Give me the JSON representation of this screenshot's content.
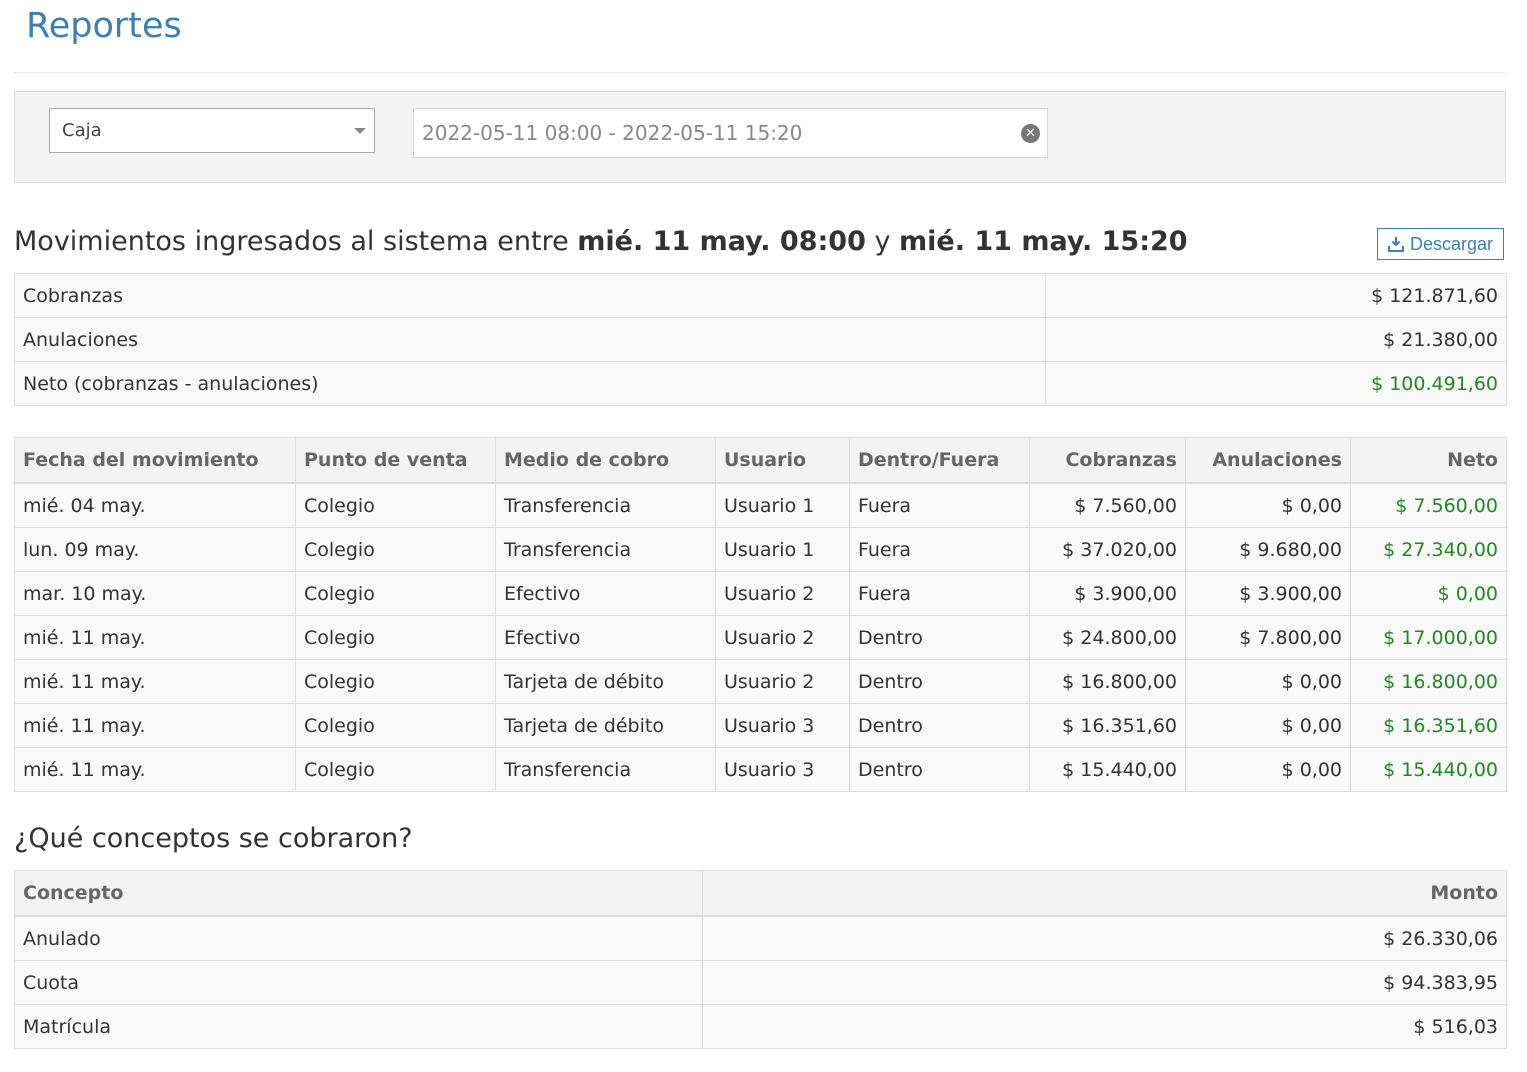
{
  "header": {
    "title": "Reportes"
  },
  "filters": {
    "select_value": "Caja",
    "date_range": "2022-05-11 08:00 - 2022-05-11 15:20",
    "clear_glyph": "✕"
  },
  "movements_heading": {
    "prefix": "Movimientos ingresados al sistema entre ",
    "start": "mié. 11 may. 08:00",
    "connector": " y ",
    "end": "mié. 11 may. 15:20"
  },
  "download_button": {
    "label": "Descargar",
    "icon": "download-icon"
  },
  "summary": [
    {
      "label": "Cobranzas",
      "value": "$ 121.871,60"
    },
    {
      "label": "Anulaciones",
      "value": "$ 21.380,00"
    },
    {
      "label": "Neto (cobranzas - anulaciones)",
      "value": "$ 100.491,60"
    }
  ],
  "movements": {
    "columns": [
      "Fecha del movimiento",
      "Punto de venta",
      "Medio de cobro",
      "Usuario",
      "Dentro/Fuera",
      "Cobranzas",
      "Anulaciones",
      "Neto"
    ],
    "rows": [
      [
        "mié. 04 may.",
        "Colegio",
        "Transferencia",
        "Usuario 1",
        "Fuera",
        "$ 7.560,00",
        "$ 0,00",
        "$ 7.560,00"
      ],
      [
        "lun. 09 may.",
        "Colegio",
        "Transferencia",
        "Usuario 1",
        "Fuera",
        "$ 37.020,00",
        "$ 9.680,00",
        "$ 27.340,00"
      ],
      [
        "mar. 10 may.",
        "Colegio",
        "Efectivo",
        "Usuario 2",
        "Fuera",
        "$ 3.900,00",
        "$ 3.900,00",
        "$ 0,00"
      ],
      [
        "mié. 11 may.",
        "Colegio",
        "Efectivo",
        "Usuario 2",
        "Dentro",
        "$ 24.800,00",
        "$ 7.800,00",
        "$ 17.000,00"
      ],
      [
        "mié. 11 may.",
        "Colegio",
        "Tarjeta de débito",
        "Usuario 2",
        "Dentro",
        "$ 16.800,00",
        "$ 0,00",
        "$ 16.800,00"
      ],
      [
        "mié. 11 may.",
        "Colegio",
        "Tarjeta de débito",
        "Usuario 3",
        "Dentro",
        "$ 16.351,60",
        "$ 0,00",
        "$ 16.351,60"
      ],
      [
        "mié. 11 may.",
        "Colegio",
        "Transferencia",
        "Usuario 3",
        "Dentro",
        "$ 15.440,00",
        "$ 0,00",
        "$ 15.440,00"
      ]
    ]
  },
  "concepts": {
    "heading": "¿Qué conceptos se cobraron?",
    "columns": [
      "Concepto",
      "Monto"
    ],
    "rows": [
      [
        "Anulado",
        "$ 26.330,06"
      ],
      [
        "Cuota",
        "$ 94.383,95"
      ],
      [
        "Matrícula",
        "$ 516,03"
      ]
    ]
  },
  "colors": {
    "accent": "#3a7fb5",
    "positive": "#1f8a1f"
  }
}
